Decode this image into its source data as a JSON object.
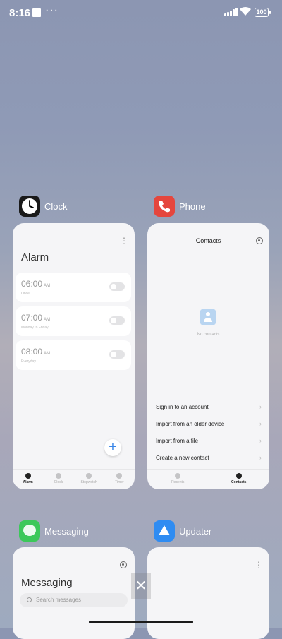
{
  "status": {
    "time": "8:16",
    "dots": "···",
    "battery": "100"
  },
  "clock": {
    "app_name": "Clock",
    "title": "Alarm",
    "alarms": [
      {
        "time": "06:00",
        "ampm": "AM",
        "sub": "Once"
      },
      {
        "time": "07:00",
        "ampm": "AM",
        "sub": "Monday to Friday"
      },
      {
        "time": "08:00",
        "ampm": "AM",
        "sub": "Everyday"
      }
    ],
    "fab": "+",
    "tabs": [
      "Alarm",
      "Clock",
      "Stopwatch",
      "Timer"
    ]
  },
  "phone": {
    "app_name": "Phone",
    "title": "Contacts",
    "empty": "No contacts",
    "options": [
      "Sign in to an account",
      "Import from an older device",
      "Import from a file",
      "Create a new contact"
    ],
    "tabs": [
      "Recents",
      "Contacts"
    ]
  },
  "messaging": {
    "app_name": "Messaging",
    "title": "Messaging",
    "search_placeholder": "Search messages"
  },
  "updater": {
    "app_name": "Updater"
  },
  "close_label": "✕"
}
